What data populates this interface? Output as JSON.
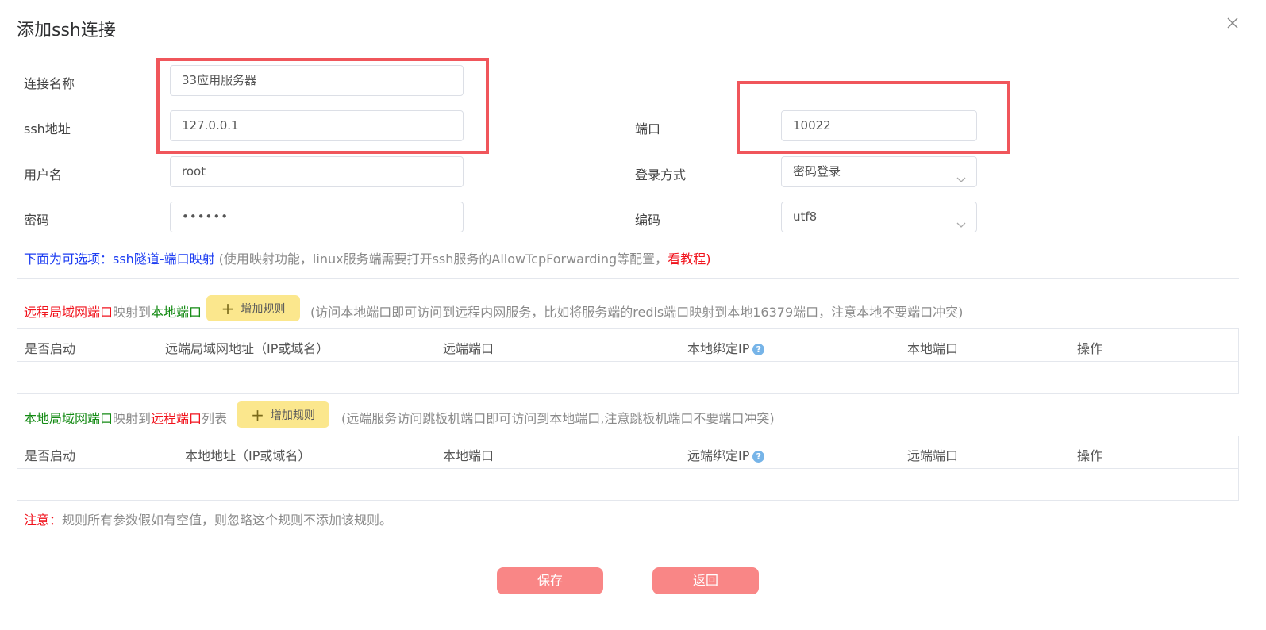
{
  "dialog": {
    "title": "添加ssh连接"
  },
  "form": {
    "name_label": "连接名称",
    "name_value": "33应用服务器",
    "host_label": "ssh地址",
    "host_value": "127.0.0.1",
    "port_label": "端口",
    "port_value": "10022",
    "user_label": "用户名",
    "user_value": "root",
    "login_label": "登录方式",
    "login_value": "密码登录",
    "password_label": "密码",
    "password_value": "••••••",
    "encoding_label": "编码",
    "encoding_value": "utf8"
  },
  "optional_note": {
    "prefix": "下面为可选项：ssh隧道-端口映射",
    "middle": " (使用映射功能，linux服务端需要打开ssh服务的AllowTcpForwarding等配置，",
    "link": "看教程",
    "suffix": ")"
  },
  "remote_to_local": {
    "part1": "远程局域网端口",
    "part2": "映射到",
    "part3": "本地端口",
    "add_label": "增加规则",
    "hint": "(访问本地端口即可访问到远程内网服务，比如将服务端的redis端口映射到本地16379端口，注意本地不要端口冲突)",
    "columns": [
      "是否启动",
      "远端局域网地址（IP或域名）",
      "远端端口",
      "本地绑定IP",
      "本地端口",
      "操作"
    ]
  },
  "local_to_remote": {
    "part1": "本地局域网端口",
    "part2": "映射到",
    "part3": "远程端口",
    "part4": "列表",
    "add_label": "增加规则",
    "hint": "(远端服务访问跳板机端口即可访问到本地端口,注意跳板机端口不要端口冲突)",
    "columns": [
      "是否启动",
      "本地地址（IP或域名）",
      "本地端口",
      "远端绑定IP",
      "远端端口",
      "操作"
    ]
  },
  "warning": {
    "label": "注意：",
    "text": "规则所有参数假如有空值，则忽略这个规则不添加该规则。"
  },
  "actions": {
    "save": "保存",
    "back": "返回"
  },
  "colors": {
    "highlight_box": "#f0565b",
    "add_button": "#fbe78d",
    "action_button": "#f98686"
  }
}
